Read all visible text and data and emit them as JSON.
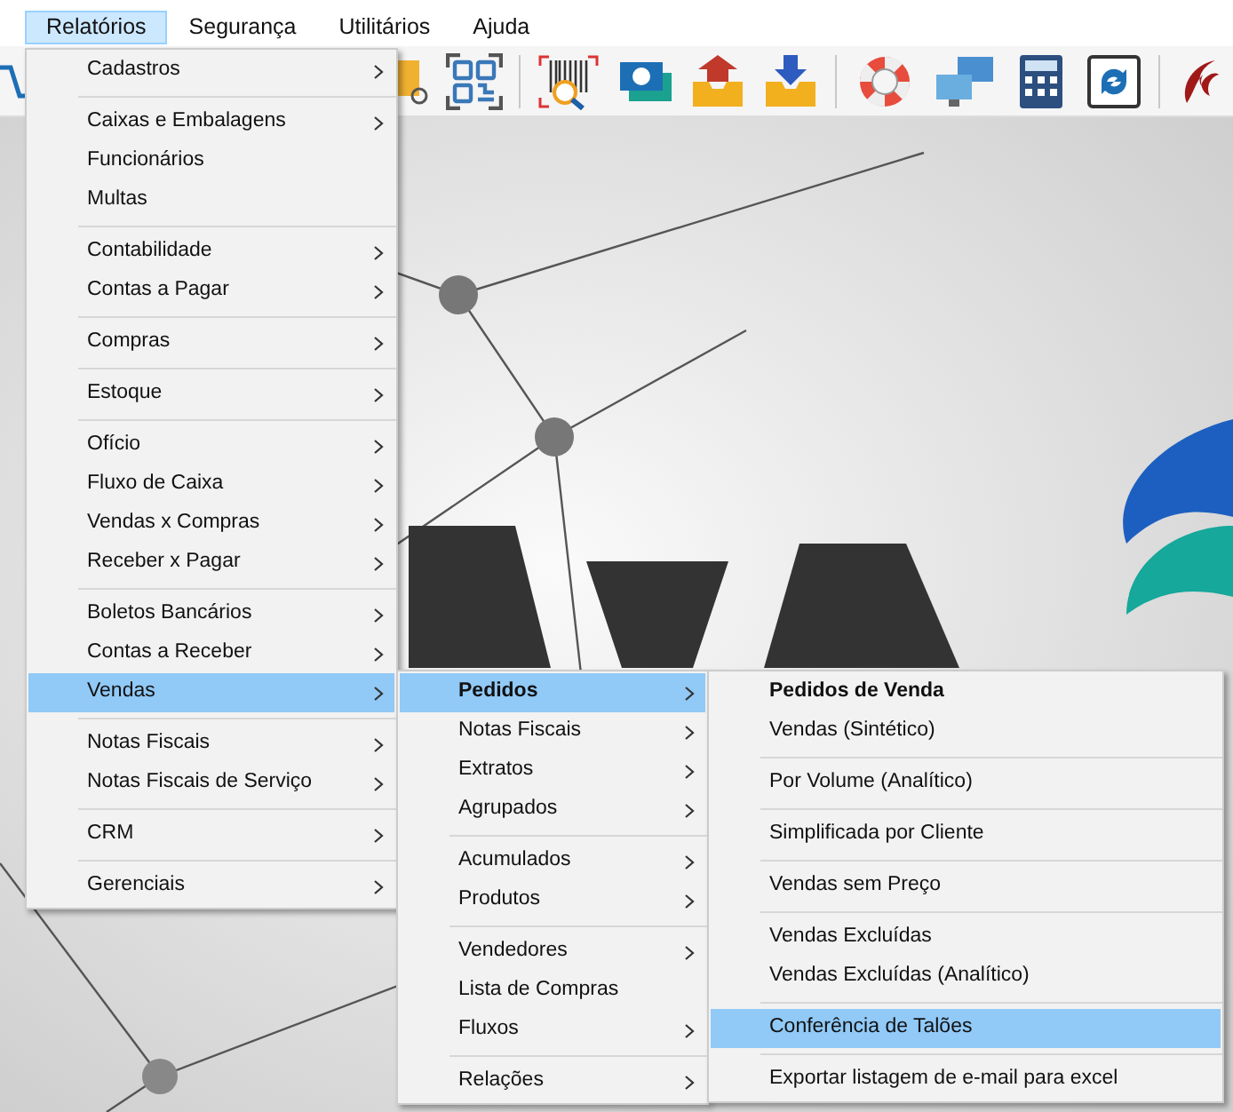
{
  "menu_bar": [
    {
      "label": "Relatórios",
      "selected": true
    },
    {
      "label": "Segurança",
      "selected": false
    },
    {
      "label": "Utilitários",
      "selected": false
    },
    {
      "label": "Ajuda",
      "selected": false
    }
  ],
  "menus": [
    {
      "groups": [
        [
          {
            "label": "Cadastros",
            "submenu": true,
            "selected": false,
            "bold": false
          }
        ],
        [
          {
            "label": "Caixas e Embalagens",
            "submenu": true,
            "selected": false,
            "bold": false
          },
          {
            "label": "Funcionários",
            "submenu": false,
            "selected": false,
            "bold": false
          },
          {
            "label": "Multas",
            "submenu": false,
            "selected": false,
            "bold": false
          }
        ],
        [
          {
            "label": "Contabilidade",
            "submenu": true,
            "selected": false,
            "bold": false
          },
          {
            "label": "Contas a Pagar",
            "submenu": true,
            "selected": false,
            "bold": false
          }
        ],
        [
          {
            "label": "Compras",
            "submenu": true,
            "selected": false,
            "bold": false
          }
        ],
        [
          {
            "label": "Estoque",
            "submenu": true,
            "selected": false,
            "bold": false
          }
        ],
        [
          {
            "label": "Ofício",
            "submenu": true,
            "selected": false,
            "bold": false
          },
          {
            "label": "Fluxo de Caixa",
            "submenu": true,
            "selected": false,
            "bold": false
          },
          {
            "label": "Vendas x Compras",
            "submenu": true,
            "selected": false,
            "bold": false
          },
          {
            "label": "Receber x Pagar",
            "submenu": true,
            "selected": false,
            "bold": false
          }
        ],
        [
          {
            "label": "Boletos Bancários",
            "submenu": true,
            "selected": false,
            "bold": false
          },
          {
            "label": "Contas a Receber",
            "submenu": true,
            "selected": false,
            "bold": false
          },
          {
            "label": "Vendas",
            "submenu": true,
            "selected": true,
            "bold": false
          }
        ],
        [
          {
            "label": "Notas Fiscais",
            "submenu": true,
            "selected": false,
            "bold": false
          },
          {
            "label": "Notas Fiscais de Serviço",
            "submenu": true,
            "selected": false,
            "bold": false
          }
        ],
        [
          {
            "label": "CRM",
            "submenu": true,
            "selected": false,
            "bold": false
          }
        ],
        [
          {
            "label": "Gerenciais",
            "submenu": true,
            "selected": false,
            "bold": false
          }
        ]
      ]
    },
    {
      "groups": [
        [
          {
            "label": "Pedidos",
            "submenu": true,
            "selected": true,
            "bold": true
          },
          {
            "label": "Notas Fiscais",
            "submenu": true,
            "selected": false,
            "bold": false
          },
          {
            "label": "Extratos",
            "submenu": true,
            "selected": false,
            "bold": false
          },
          {
            "label": "Agrupados",
            "submenu": true,
            "selected": false,
            "bold": false
          }
        ],
        [
          {
            "label": "Acumulados",
            "submenu": true,
            "selected": false,
            "bold": false
          },
          {
            "label": "Produtos",
            "submenu": true,
            "selected": false,
            "bold": false
          }
        ],
        [
          {
            "label": "Vendedores",
            "submenu": true,
            "selected": false,
            "bold": false
          },
          {
            "label": "Lista de Compras",
            "submenu": false,
            "selected": false,
            "bold": false
          },
          {
            "label": "Fluxos",
            "submenu": true,
            "selected": false,
            "bold": false
          }
        ],
        [
          {
            "label": "Relações",
            "submenu": true,
            "selected": false,
            "bold": false
          }
        ]
      ]
    },
    {
      "groups": [
        [
          {
            "label": "Pedidos de Venda",
            "submenu": false,
            "selected": false,
            "bold": true
          },
          {
            "label": "Vendas (Sintético)",
            "submenu": false,
            "selected": false,
            "bold": false
          }
        ],
        [
          {
            "label": "Por Volume (Analítico)",
            "submenu": false,
            "selected": false,
            "bold": false
          }
        ],
        [
          {
            "label": "Simplificada por Cliente",
            "submenu": false,
            "selected": false,
            "bold": false
          }
        ],
        [
          {
            "label": "Vendas sem Preço",
            "submenu": false,
            "selected": false,
            "bold": false
          }
        ],
        [
          {
            "label": "Vendas Excluídas",
            "submenu": false,
            "selected": false,
            "bold": false
          },
          {
            "label": "Vendas Excluídas (Analítico)",
            "submenu": false,
            "selected": false,
            "bold": false
          }
        ],
        [
          {
            "label": "Conferência de Talões",
            "submenu": false,
            "selected": true,
            "bold": false
          }
        ],
        [
          {
            "label": "Exportar listagem de e-mail para excel",
            "submenu": false,
            "selected": false,
            "bold": false
          }
        ]
      ]
    }
  ]
}
